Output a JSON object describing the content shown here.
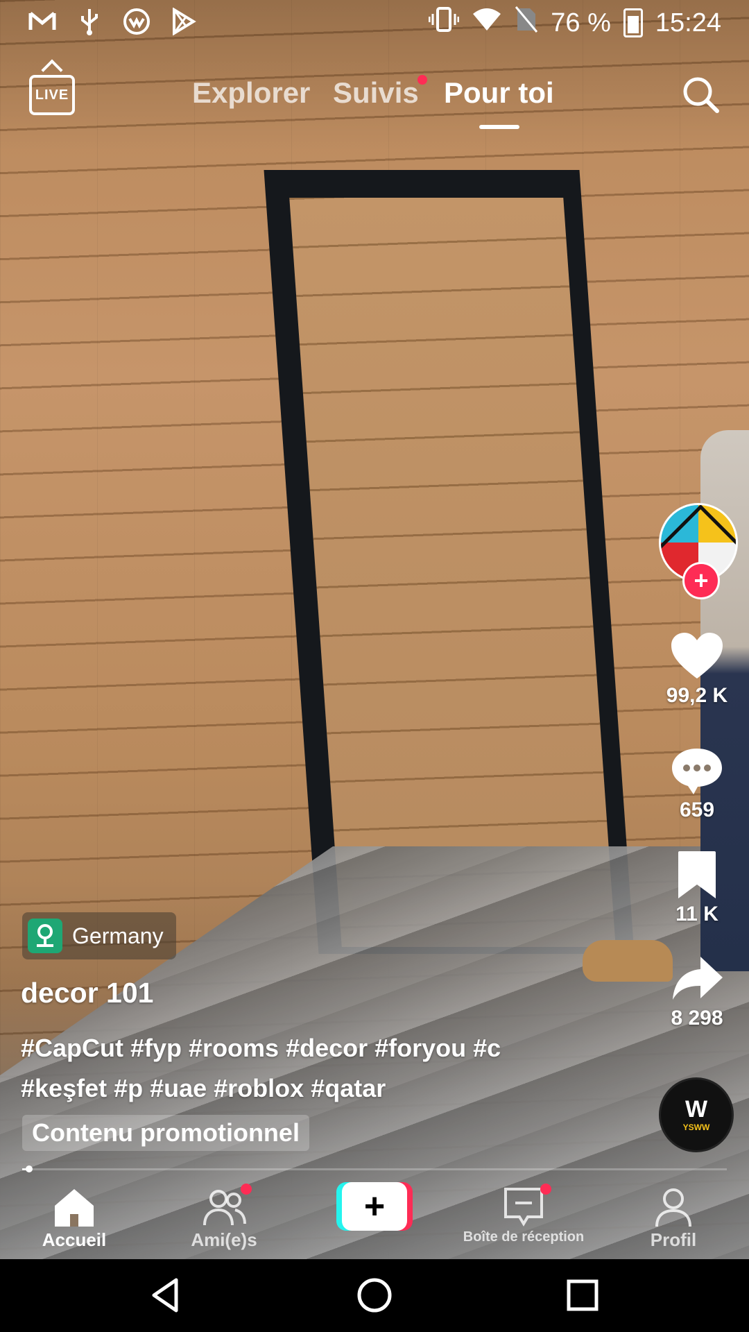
{
  "status_bar": {
    "battery": "76 %",
    "time": "15:24",
    "left_icons": [
      "gmail-icon",
      "usb-icon",
      "vpn-icon",
      "play-store-icon"
    ]
  },
  "top_nav": {
    "live_label": "LIVE",
    "tabs": [
      {
        "label": "Explorer",
        "active": false
      },
      {
        "label": "Suivis",
        "active": false,
        "notification_dot": true
      },
      {
        "label": "Pour toi",
        "active": true
      }
    ]
  },
  "actions": {
    "likes": "99,2 K",
    "comments": "659",
    "saves": "11 K",
    "shares": "8 298",
    "music_disc_text": "YSWW"
  },
  "post": {
    "location": "Germany",
    "username": "decor 101",
    "hashtags_line1": "#CapCut #fyp #rooms #decor #foryou #c",
    "hashtags_line2": "#keşfet #p #uae #roblox #qatar",
    "promo_label": "Contenu promotionnel",
    "progress_fraction": 0.01
  },
  "bottom_nav": {
    "items": [
      {
        "label": "Accueil",
        "icon": "home-icon",
        "active": true
      },
      {
        "label": "Ami(e)s",
        "icon": "friends-icon",
        "notification_dot": true
      },
      {
        "label": "",
        "icon": "create-plus-icon"
      },
      {
        "label": "Boîte de réception",
        "icon": "inbox-icon",
        "notification_dot": true
      },
      {
        "label": "Profil",
        "icon": "profile-icon"
      }
    ]
  },
  "colors": {
    "accent_red": "#fe2c55",
    "accent_cyan": "#25f4ee",
    "location_green": "#1ea774"
  }
}
